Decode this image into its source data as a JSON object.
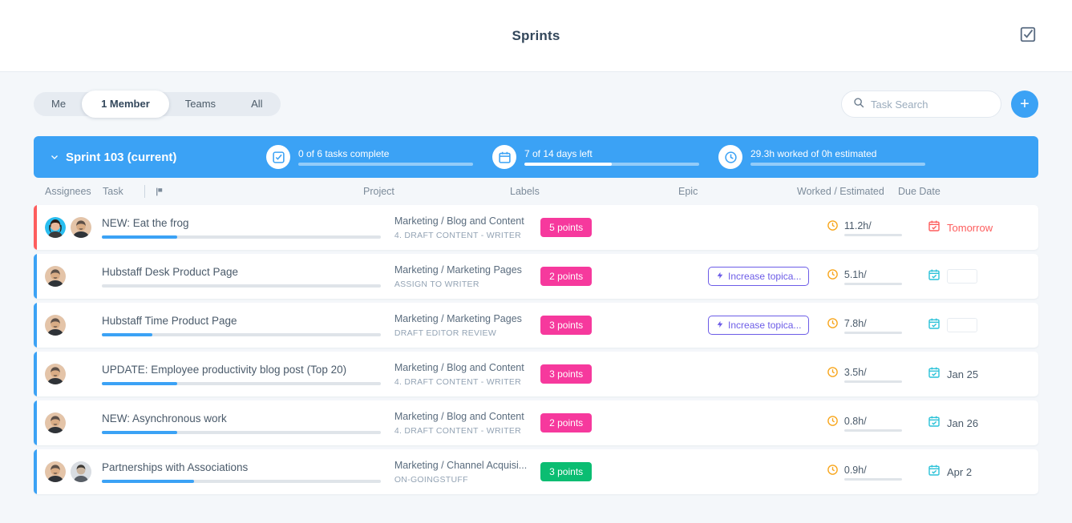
{
  "topbar": {
    "title": "Sprints",
    "action_icon": "checklist-icon"
  },
  "filters": {
    "tabs": [
      {
        "label": "Me",
        "active": false
      },
      {
        "label": "1 Member",
        "active": true
      },
      {
        "label": "Teams",
        "active": false
      },
      {
        "label": "All",
        "active": false
      }
    ],
    "search_placeholder": "Task Search",
    "search_value": "",
    "add_label": "+"
  },
  "sprint": {
    "name": "Sprint 103 (current)",
    "accent": "#3ba2f5",
    "metrics": [
      {
        "icon": "tasks-check-icon",
        "label": "0 of 6 tasks complete",
        "percent": 0
      },
      {
        "icon": "calendar-icon",
        "label": "7 of 14 days left",
        "percent": 50
      },
      {
        "icon": "clock-icon",
        "label": "29.3h worked of 0h estimated",
        "percent": 0
      }
    ]
  },
  "columns": {
    "assignees": "Assignees",
    "task": "Task",
    "flag": "flag-icon",
    "project": "Project",
    "labels": "Labels",
    "epic": "Epic",
    "worked": "Worked / Estimated",
    "due": "Due Date"
  },
  "tasks": [
    {
      "strip_color": "#fd5d5d",
      "avatars": [
        "female-avatar",
        "male-avatar"
      ],
      "title": "NEW: Eat the frog",
      "progress": 27,
      "project": "Marketing / Blog and Content",
      "status": "4. DRAFT CONTENT - WRITER",
      "label": "5 points",
      "label_color": "#f6399d",
      "epic": "",
      "worked": "11.2h/",
      "due": "Tomorrow",
      "due_overdue": true,
      "due_empty": false
    },
    {
      "strip_color": "#3ba2f5",
      "avatars": [
        "male-avatar"
      ],
      "title": "Hubstaff Desk Product Page",
      "progress": 0,
      "project": "Marketing / Marketing Pages",
      "status": "ASSIGN TO WRITER",
      "label": "2 points",
      "label_color": "#f6399d",
      "epic": "Increase topica...",
      "worked": "5.1h/",
      "due": "",
      "due_overdue": false,
      "due_empty": true
    },
    {
      "strip_color": "#3ba2f5",
      "avatars": [
        "male-avatar"
      ],
      "title": "Hubstaff Time Product Page",
      "progress": 18,
      "project": "Marketing / Marketing Pages",
      "status": "DRAFT EDITOR REVIEW",
      "label": "3 points",
      "label_color": "#f6399d",
      "epic": "Increase topica...",
      "worked": "7.8h/",
      "due": "",
      "due_overdue": false,
      "due_empty": true
    },
    {
      "strip_color": "#3ba2f5",
      "avatars": [
        "male-avatar"
      ],
      "title": "UPDATE: Employee productivity blog post (Top 20)",
      "progress": 27,
      "project": "Marketing / Blog and Content",
      "status": "4. DRAFT CONTENT - WRITER",
      "label": "3 points",
      "label_color": "#f6399d",
      "epic": "",
      "worked": "3.5h/",
      "due": "Jan 25",
      "due_overdue": false,
      "due_empty": false
    },
    {
      "strip_color": "#3ba2f5",
      "avatars": [
        "male-avatar"
      ],
      "title": "NEW: Asynchronous work",
      "progress": 27,
      "project": "Marketing / Blog and Content",
      "status": "4. DRAFT CONTENT - WRITER",
      "label": "2 points",
      "label_color": "#f6399d",
      "epic": "",
      "worked": "0.8h/",
      "due": "Jan 26",
      "due_overdue": false,
      "due_empty": false
    },
    {
      "strip_color": "#3ba2f5",
      "avatars": [
        "male-avatar",
        "grey-avatar"
      ],
      "title": "Partnerships with Associations",
      "progress": 33,
      "project": "Marketing / Channel Acquisi...",
      "status": "ON-GOINGSTUFF",
      "label": "3 points",
      "label_color": "#0bbd72",
      "epic": "",
      "worked": "0.9h/",
      "due": "Apr 2",
      "due_overdue": false,
      "due_empty": false
    }
  ]
}
